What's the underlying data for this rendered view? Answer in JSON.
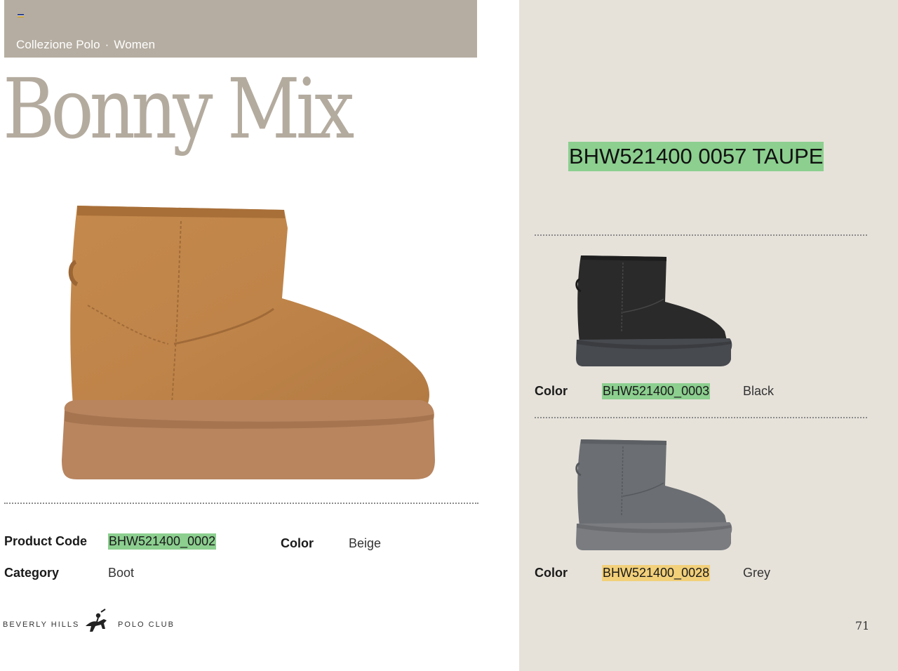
{
  "header": {
    "breadcrumb": [
      "Collezione Polo",
      "·",
      "Women"
    ],
    "title": "Bonny Mix"
  },
  "main_product": {
    "image_icon": "boot-beige-icon",
    "product_code_label": "Product Code",
    "product_code": "BHW521400_0002",
    "color_label": "Color",
    "color": "Beige",
    "category_label": "Category",
    "category": "Boot"
  },
  "footer": {
    "brand_left": "BEVERLY HILLS",
    "brand_logo_icon": "polo-player-logo-icon",
    "brand_right": "POLO CLUB",
    "page_number": "71"
  },
  "side_panel": {
    "highlight_code": "BHW521400 0057 TAUPE",
    "variants": [
      {
        "label": "Color",
        "code": "BHW521400_0003",
        "color": "Black",
        "image_icon": "boot-black-icon",
        "highlight": "#8ccf8f"
      },
      {
        "label": "Color",
        "code": "BHW521400_0028",
        "color": "Grey",
        "image_icon": "boot-grey-icon",
        "highlight": "#f2d07a"
      }
    ]
  },
  "colors": {
    "header_band": "#b5ada1",
    "title": "#b4ab9f",
    "panel": "#e6e2da",
    "code_highlight_green": "#8ccf8f",
    "code_highlight_yellow": "#f2d07a"
  }
}
